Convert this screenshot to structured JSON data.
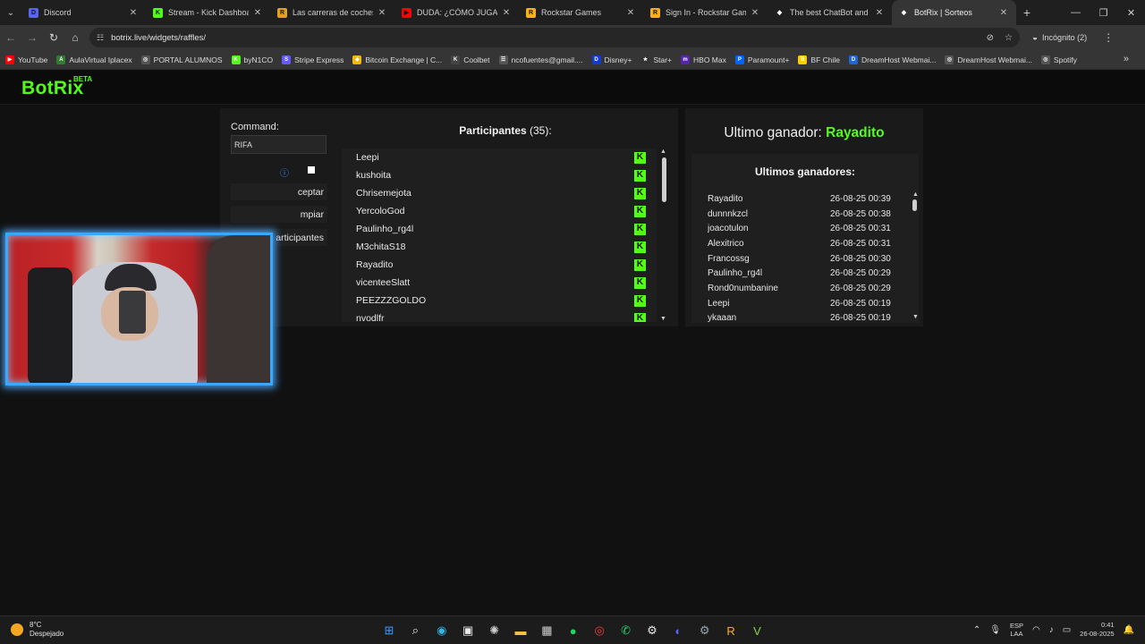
{
  "browser": {
    "tabs": [
      {
        "label": "Discord",
        "icon": "discord-icon",
        "color": "#5865f2",
        "glyph": "D"
      },
      {
        "label": "Stream - Kick Dashboard",
        "icon": "kick-icon",
        "color": "#53fc18",
        "glyph": "K"
      },
      {
        "label": "Las carreras de coches de",
        "icon": "news-icon",
        "color": "#e3a11b",
        "glyph": "R"
      },
      {
        "label": "DUDA: ¿CÓMO JUGAR *C",
        "icon": "youtube-icon",
        "color": "#ff0000",
        "glyph": "▶"
      },
      {
        "label": "Rockstar Games",
        "icon": "rockstar-icon",
        "color": "#fcaf17",
        "glyph": "R"
      },
      {
        "label": "Sign In - Rockstar Games",
        "icon": "rockstar-icon",
        "color": "#fcaf17",
        "glyph": "R"
      },
      {
        "label": "The best ChatBot and Wi",
        "icon": "botrix-icon",
        "color": "#ffffff",
        "glyph": "◆"
      },
      {
        "label": "BotRix | Sorteos",
        "icon": "botrix-icon",
        "color": "#ffffff",
        "glyph": "◆"
      }
    ],
    "active_tab": 7,
    "url": "botrix.live/widgets/raffles/",
    "incognito_label": "Incógnito (2)"
  },
  "bookmarks": [
    {
      "label": "YouTube",
      "color": "#ff0000",
      "glyph": "▶"
    },
    {
      "label": "AulaVirtual Iplacex",
      "color": "#2e7d32",
      "glyph": "A"
    },
    {
      "label": "PORTAL ALUMNOS",
      "color": "#555555",
      "glyph": "◎"
    },
    {
      "label": "byN1CO",
      "color": "#53fc18",
      "glyph": "K"
    },
    {
      "label": "Stripe Express",
      "color": "#635bff",
      "glyph": "S"
    },
    {
      "label": "Bitcoin Exchange | C...",
      "color": "#f0b90b",
      "glyph": "◆"
    },
    {
      "label": "Coolbet",
      "color": "#444444",
      "glyph": "K"
    },
    {
      "label": "ncofuentes@gmail....",
      "color": "#555555",
      "glyph": "☰"
    },
    {
      "label": "Disney+",
      "color": "#113ccf",
      "glyph": "D"
    },
    {
      "label": "Star+",
      "color": "#333333",
      "glyph": "★"
    },
    {
      "label": "HBO Max",
      "color": "#5822b4",
      "glyph": "m"
    },
    {
      "label": "Paramount+",
      "color": "#0064ff",
      "glyph": "P"
    },
    {
      "label": "BF Chile",
      "color": "#ffcc00",
      "glyph": "B"
    },
    {
      "label": "DreamHost Webmai...",
      "color": "#1e66d6",
      "glyph": "D"
    },
    {
      "label": "DreamHost Webmai...",
      "color": "#555555",
      "glyph": "◎"
    },
    {
      "label": "Spotify",
      "color": "#555555",
      "glyph": "◎"
    }
  ],
  "page": {
    "logo": "BotRix",
    "logo_badge": "BETA",
    "command_label": "Command:",
    "command_value": "RIFA",
    "buttons": [
      "ceptar",
      "mpiar",
      "articipantes"
    ],
    "participants_title": "Participantes",
    "participants_count": "(35):",
    "participants": [
      "Leepi",
      "kushoita",
      "Chrisemejota",
      "YercoloGod",
      "Paulinho_rg4l",
      "M3chitaS18",
      "Rayadito",
      "vicenteeSlatt",
      "PEEZZZGOLDO",
      "nvodlfr"
    ],
    "last_winner_label": "Ultimo ganador:",
    "last_winner_name": "Rayadito",
    "winners_title": "Ultimos ganadores:",
    "winners": [
      {
        "name": "Rayadito",
        "date": "26-08-25 00:39"
      },
      {
        "name": "dunnnkzcl",
        "date": "26-08-25 00:38"
      },
      {
        "name": "joacotulon",
        "date": "26-08-25 00:31"
      },
      {
        "name": "Alexitrico",
        "date": "26-08-25 00:31"
      },
      {
        "name": "Francossg",
        "date": "26-08-25 00:30"
      },
      {
        "name": "Paulinho_rg4l",
        "date": "26-08-25 00:29"
      },
      {
        "name": "Rond0numbanine",
        "date": "26-08-25 00:29"
      },
      {
        "name": "Leepi",
        "date": "26-08-25 00:19"
      },
      {
        "name": "ykaaan",
        "date": "26-08-25 00:19"
      }
    ]
  },
  "taskbar": {
    "temp": "8°C",
    "weather": "Despejado",
    "lang_top": "ESP",
    "lang_bottom": "LAA",
    "time": "0:41",
    "date": "26-08-2025"
  }
}
